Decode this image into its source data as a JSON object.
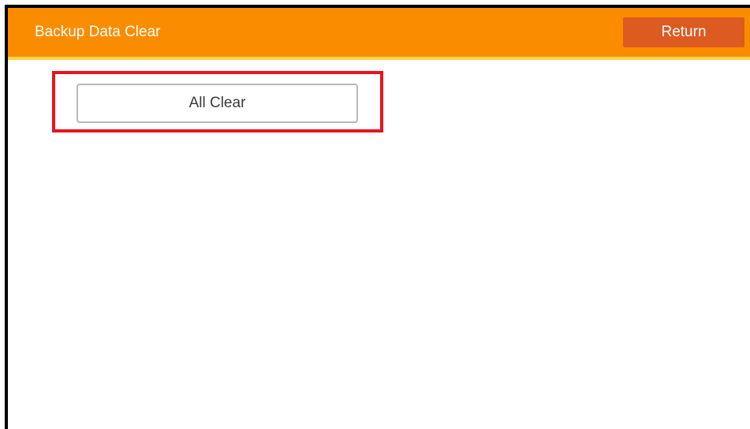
{
  "header": {
    "title": "Backup Data Clear",
    "return_label": "Return"
  },
  "main": {
    "all_clear_label": "All Clear"
  },
  "colors": {
    "header_bg": "#fa8c00",
    "header_accent_line": "#fdd24a",
    "return_button_bg": "#dd5a20",
    "highlight_border": "#e8141e"
  }
}
